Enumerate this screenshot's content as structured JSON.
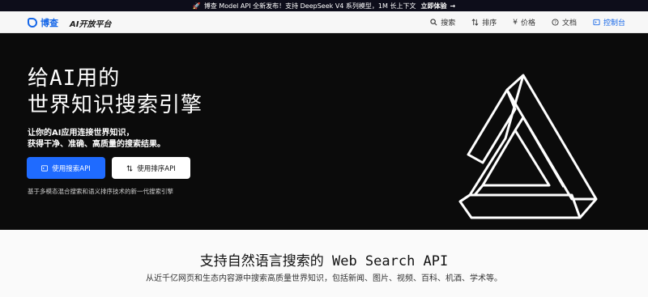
{
  "announcement": {
    "icon": "rocket-icon",
    "text": "博查 Model API 全新发布！支持 DeepSeek V4 系列模型，1M 长上下文",
    "cta": "立即体验",
    "arrow": "→"
  },
  "nav": {
    "brand": "博查",
    "platform": "AI开放平台",
    "links": [
      {
        "label": "搜索",
        "icon": "search-icon"
      },
      {
        "label": "排序",
        "icon": "sort-icon"
      },
      {
        "label": "价格",
        "icon": "yen-icon"
      },
      {
        "label": "文档",
        "icon": "help-icon"
      },
      {
        "label": "控制台",
        "icon": "console-icon"
      }
    ],
    "accent": "#1667e8"
  },
  "hero": {
    "title_line1": "给AI用的",
    "title_line2": "世界知识搜索引擎",
    "sub_line1": "让你的AI应用连接世界知识，",
    "sub_line2": "获得干净、准确、高质量的搜索结果。",
    "primary_button": "使用搜索API",
    "secondary_button": "使用排序API",
    "caption": "基于多模态混合搜索和语义排序技术的新一代搜索引擎"
  },
  "section": {
    "title": "支持自然语言搜索的 Web Search API",
    "subtitle": "从近千亿网页和生态内容源中搜索高质量世界知识，包括新闻、图片、视频、百科、机酒、学术等。"
  }
}
